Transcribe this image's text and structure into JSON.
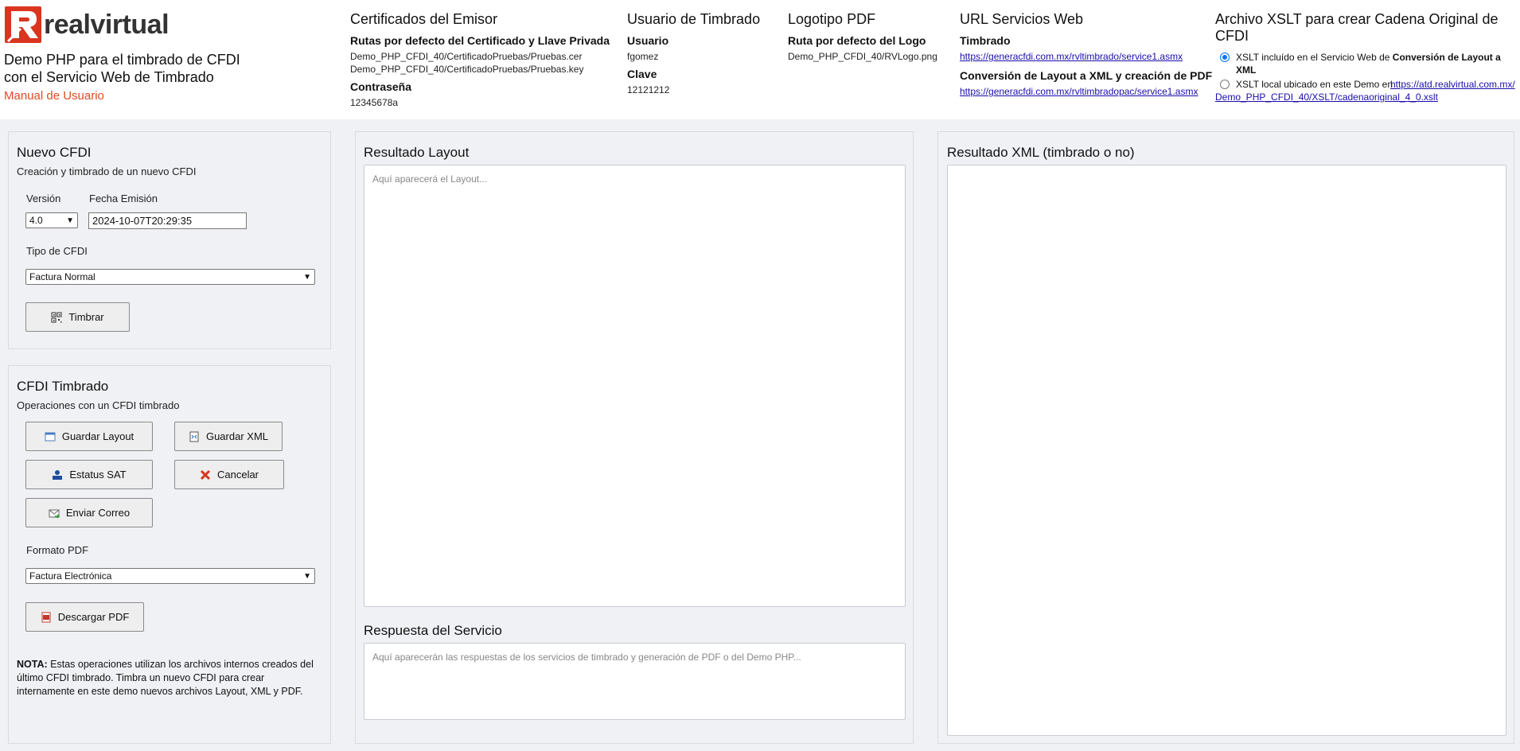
{
  "header": {
    "logo_text": "realvirtual",
    "demo_title": "Demo PHP para el timbrado de CFDI con el Servicio Web de Timbrado",
    "manual_link": "Manual de Usuario",
    "certificados": {
      "title": "Certificados del Emisor",
      "rutas_label": "Rutas por defecto del Certificado y Llave Privada",
      "cer_path": "Demo_PHP_CFDI_40/CertificadoPruebas/Pruebas.cer",
      "key_path": "Demo_PHP_CFDI_40/CertificadoPruebas/Pruebas.key",
      "password_label": "Contraseña",
      "password_value": "12345678a"
    },
    "usuario": {
      "title": "Usuario de Timbrado",
      "user_label": "Usuario",
      "user_value": "fgomez",
      "clave_label": "Clave",
      "clave_value": "12121212"
    },
    "logotipo": {
      "title": "Logotipo PDF",
      "ruta_label": "Ruta por defecto del Logo",
      "ruta_value": "Demo_PHP_CFDI_40/RVLogo.png"
    },
    "url_servicios": {
      "title": "URL Servicios Web",
      "timbrado_label": "Timbrado",
      "timbrado_url": "https://generacfdi.com.mx/rvltimbrado/service1.asmx",
      "conversion_label": "Conversión de Layout a XML y creación de PDF",
      "conversion_url": "https://generacfdi.com.mx/rvltimbradopac/service1.asmx"
    },
    "xslt": {
      "title": "Archivo XSLT para crear Cadena Original de CFDI",
      "option1_text": "XSLT incluído en el Servicio Web de ",
      "option1_bold": "Conversión de Layout a XML",
      "option2_text": "XSLT local ubicado en este Demo en ",
      "option2_link": "https://atd.realvirtual.com.mx/Demo_PHP_CFDI_40/XSLT/cadenaoriginal_4_0.xslt"
    }
  },
  "nuevo_cfdi": {
    "title": "Nuevo CFDI",
    "subtitle": "Creación y timbrado de un nuevo CFDI",
    "version_label": "Versión",
    "version_value": "4.0",
    "fecha_label": "Fecha Emisión",
    "fecha_value": "2024-10-07T20:29:35",
    "tipo_label": "Tipo de CFDI",
    "tipo_value": "Factura Normal",
    "timbrar_label": "Timbrar"
  },
  "cfdi_timbrado": {
    "title": "CFDI Timbrado",
    "subtitle": "Operaciones con un CFDI timbrado",
    "guardar_layout": "Guardar Layout",
    "guardar_xml": "Guardar XML",
    "estatus_sat": "Estatus SAT",
    "cancelar": "Cancelar",
    "enviar_correo": "Enviar Correo",
    "formato_label": "Formato PDF",
    "formato_value": "Factura Electrónica",
    "descargar_pdf": "Descargar PDF",
    "note_bold": "NOTA:",
    "note_text": " Estas operaciones utilizan los archivos internos creados del último CFDI timbrado. Timbra un nuevo CFDI para crear internamente en este demo nuevos archivos Layout, XML y PDF."
  },
  "resultado_layout": {
    "title": "Resultado Layout",
    "placeholder": "Aquí aparecerá el Layout..."
  },
  "respuesta_servicio": {
    "title": "Respuesta del Servicio",
    "placeholder": "Aquí aparecerán las respuestas de los servicios de timbrado y generación de PDF o del Demo PHP..."
  },
  "resultado_xml": {
    "title": "Resultado XML (timbrado o no)"
  },
  "colors": {
    "brand": "#d9351f",
    "link": "#1a0dab",
    "manual": "#e04a21"
  }
}
